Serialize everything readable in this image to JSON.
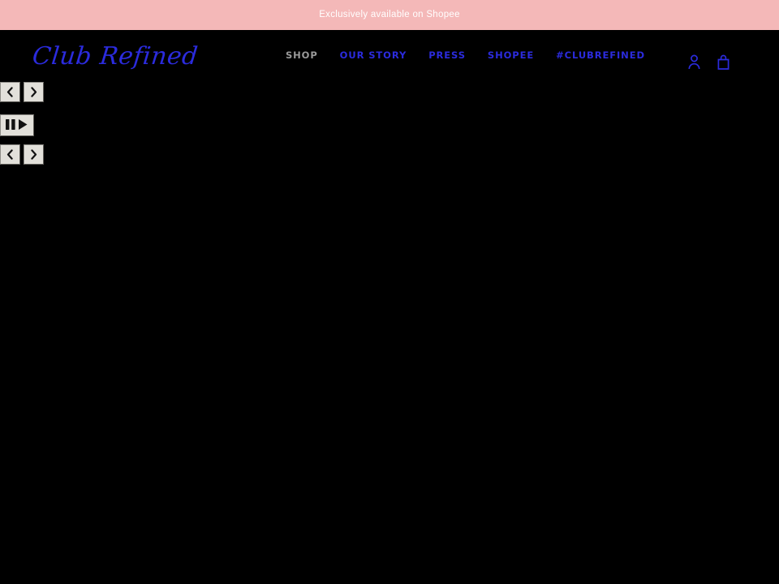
{
  "announcement": {
    "text": "Exclusively available on Shopee"
  },
  "header": {
    "brand": "Club Refined",
    "nav": [
      {
        "label": "SHOP",
        "name": "nav-link-shop",
        "active": true
      },
      {
        "label": "OUR STORY",
        "name": "nav-link-our-story",
        "active": false
      },
      {
        "label": "PRESS",
        "name": "nav-link-press",
        "active": false
      },
      {
        "label": "SHOPEE",
        "name": "nav-link-shopee",
        "active": false
      },
      {
        "label": "#CLUBREFINED",
        "name": "nav-link-clubrefined",
        "active": false
      }
    ],
    "actions": [
      {
        "icon": "account-icon",
        "label": "Account"
      },
      {
        "icon": "shopping-bag-icon",
        "label": "Cart"
      }
    ]
  },
  "slideshow_controls": {
    "top_row": [
      {
        "icon": "chevron-left-icon",
        "label": "Previous slide"
      },
      {
        "icon": "chevron-right-icon",
        "label": "Next slide"
      }
    ],
    "play_pause": {
      "icon": "pause-play-icon",
      "label": "Pause / Play slideshow"
    },
    "bottom_row": [
      {
        "icon": "chevron-left-icon",
        "label": "Previous slide"
      },
      {
        "icon": "chevron-right-icon",
        "label": "Next slide"
      }
    ]
  },
  "colors": {
    "announcement_bg": "#f4b8b8",
    "announcement_text": "#ffffff",
    "page_bg": "#000000",
    "brand_blue": "#2b2bdd",
    "nav_active": "#9a9a9a",
    "control_face": "#e2e0da"
  }
}
